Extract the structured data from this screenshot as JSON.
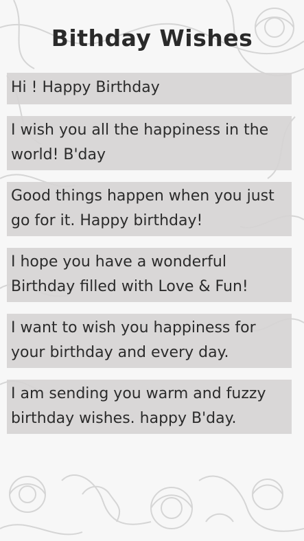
{
  "app": {
    "title": "Bithday Wishes"
  },
  "wishes": [
    {
      "text": "Hi ! Happy Birthday"
    },
    {
      "text": "I wish you all the happiness in the world! B'day"
    },
    {
      "text": "Good things happen when you just go for it. Happy birthday!"
    },
    {
      "text": "I hope you have a wonderful Birthday filled with Love & Fun!"
    },
    {
      "text": "I want to wish you happiness for your birthday and every day."
    },
    {
      "text": "I am sending you warm and fuzzy birthday wishes. happy B'day."
    }
  ],
  "colors": {
    "background": "#f7f7f7",
    "card": "#d6d4d4",
    "text": "#2b2b2b",
    "title": "#2a2a2a",
    "decoration": "#d9d9d9"
  },
  "icons": {
    "background": "floral-sketch-pattern"
  }
}
